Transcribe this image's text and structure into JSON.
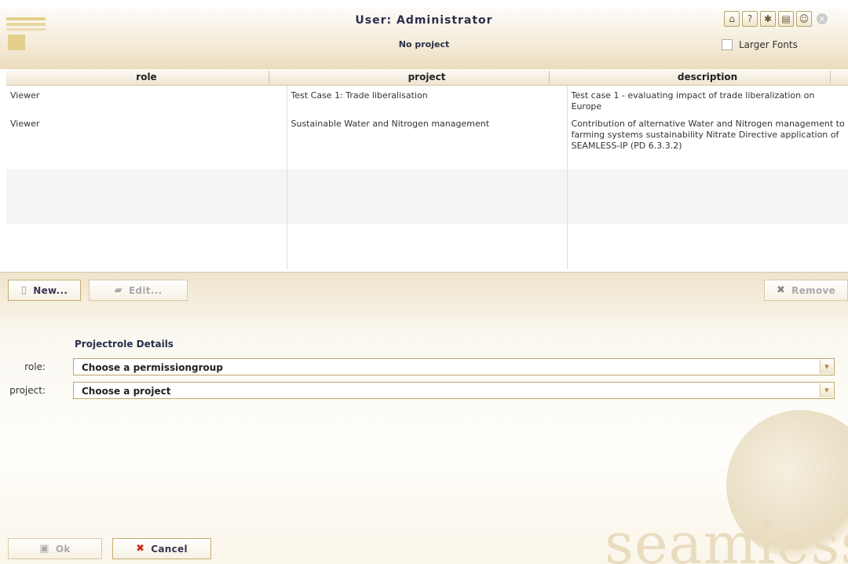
{
  "header": {
    "title": "User: Administrator",
    "subtitle": "No project",
    "larger_fonts_label": "Larger Fonts",
    "icons": [
      "home-icon",
      "help-icon",
      "bug-icon",
      "book-icon",
      "users-icon",
      "close-icon"
    ]
  },
  "table": {
    "columns": [
      "role",
      "project",
      "description"
    ],
    "rows": [
      {
        "role": "Viewer",
        "project": "Test Case 1: Trade liberalisation",
        "description": "Test case 1  - evaluating impact of trade liberalization on Europe"
      },
      {
        "role": "Viewer",
        "project": "Sustainable Water and Nitrogen management",
        "description": "Contribution of alternative Water and Nitrogen management to farming systems sustainability Nitrate Directive application of SEAMLESS-IP (PD 6.3.3.2)"
      }
    ]
  },
  "toolbar": {
    "new_label": "New...",
    "edit_label": "Edit...",
    "remove_label": "Remove"
  },
  "details": {
    "section_title": "Projectrole Details",
    "role_label": "role:",
    "role_value": "Choose a permissiongroup",
    "project_label": "project:",
    "project_value": "Choose a project"
  },
  "footer": {
    "ok_label": "Ok",
    "cancel_label": "Cancel",
    "watermark": "seamless"
  },
  "colors": {
    "header_bg": "#f2e8d3",
    "border_gold": "#c3ad70",
    "cancel_icon": "#d12a1f",
    "title_text": "#2b2f4a"
  }
}
